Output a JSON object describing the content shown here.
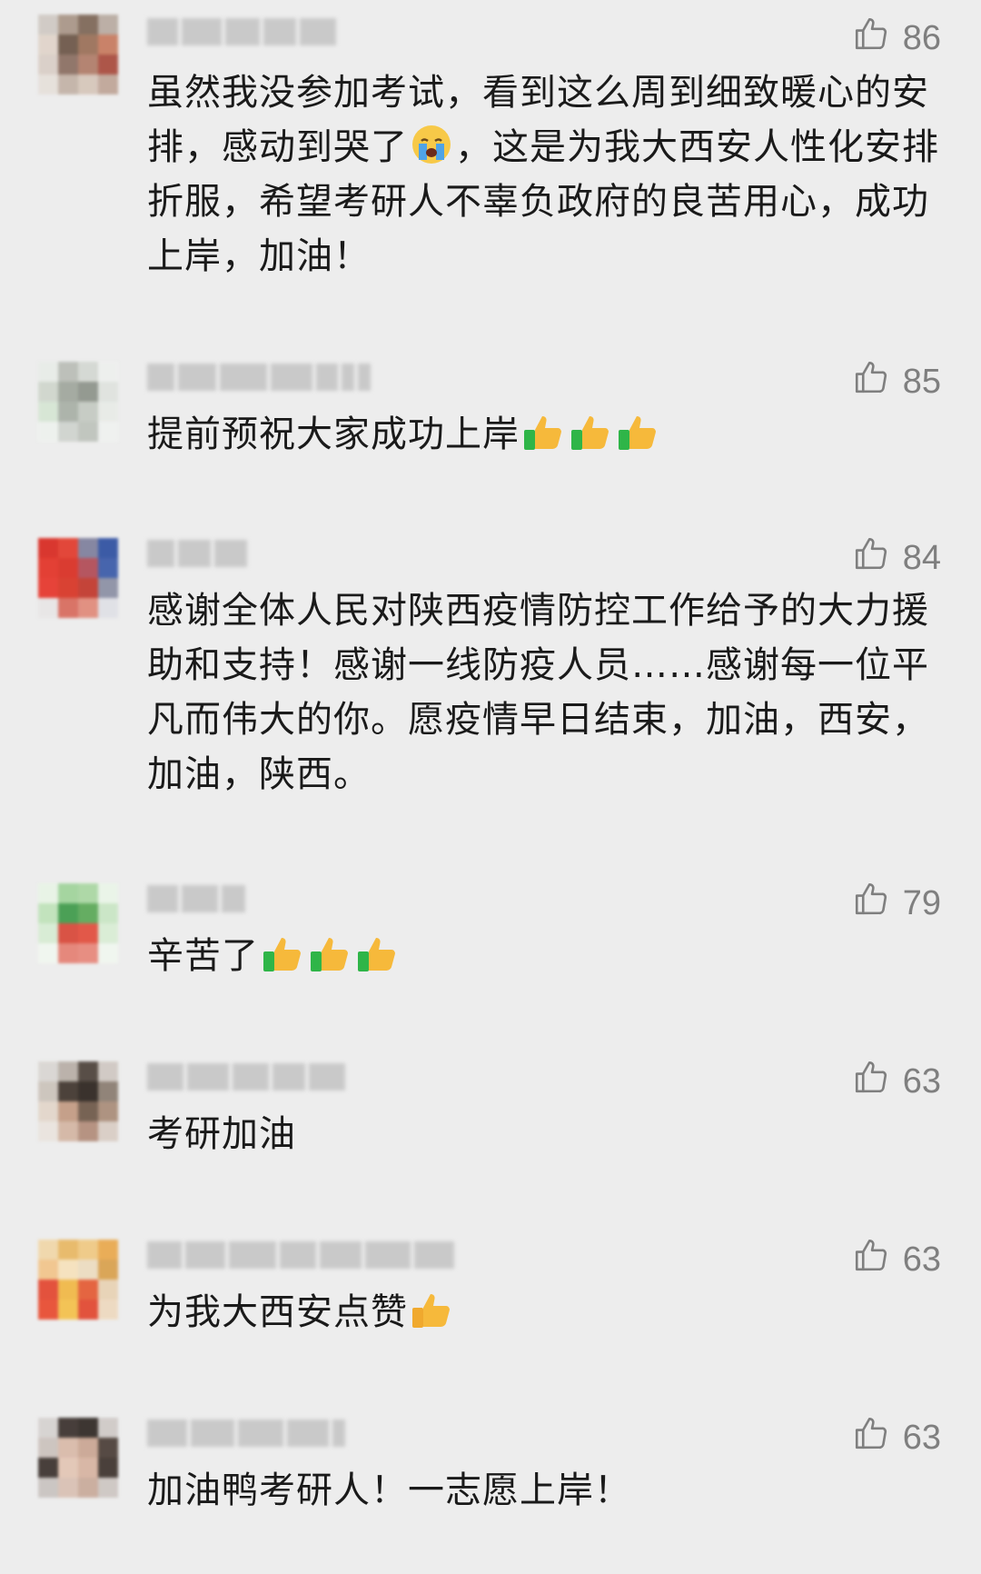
{
  "comments": [
    {
      "likes": "86",
      "segments": [
        {
          "t": "text",
          "v": "虽然我没参加考试，看到这么周到细致暖心的安排，感动到哭了"
        },
        {
          "t": "emoji",
          "v": "crying-face-icon"
        },
        {
          "t": "text",
          "v": "，这是为我大西安人性化安排折服，希望考研人不辜负政府的良苦用心，成功上岸，加油！"
        }
      ]
    },
    {
      "likes": "85",
      "segments": [
        {
          "t": "text",
          "v": "提前预祝大家成功上岸"
        },
        {
          "t": "emoji",
          "v": "thumbs-up-icon"
        },
        {
          "t": "emoji",
          "v": "thumbs-up-icon"
        },
        {
          "t": "emoji",
          "v": "thumbs-up-icon"
        }
      ]
    },
    {
      "likes": "84",
      "segments": [
        {
          "t": "text",
          "v": "感谢全体人民对陕西疫情防控工作给予的大力援助和支持！感谢一线防疫人员……感谢每一位平凡而伟大的你。愿疫情早日结束，加油，西安，加油，陕西。"
        }
      ]
    },
    {
      "likes": "79",
      "segments": [
        {
          "t": "text",
          "v": "辛苦了"
        },
        {
          "t": "emoji",
          "v": "thumbs-up-icon"
        },
        {
          "t": "emoji",
          "v": "thumbs-up-icon"
        },
        {
          "t": "emoji",
          "v": "thumbs-up-icon"
        }
      ]
    },
    {
      "likes": "63",
      "segments": [
        {
          "t": "text",
          "v": "考研加油"
        }
      ]
    },
    {
      "likes": "63",
      "segments": [
        {
          "t": "text",
          "v": "为我大西安点赞"
        },
        {
          "t": "emoji",
          "v": "thumbs-up-icon"
        }
      ]
    },
    {
      "likes": "63",
      "segments": [
        {
          "t": "text",
          "v": "加油鸭考研人！一志愿上岸！"
        }
      ]
    }
  ],
  "colors": {
    "background": "#ededed",
    "text": "#1a1a1a",
    "like_icon": "#7f7f7f",
    "thumbs_emoji_hand": "#f6b93b",
    "thumbs_emoji_cuff": "#2fb548"
  }
}
